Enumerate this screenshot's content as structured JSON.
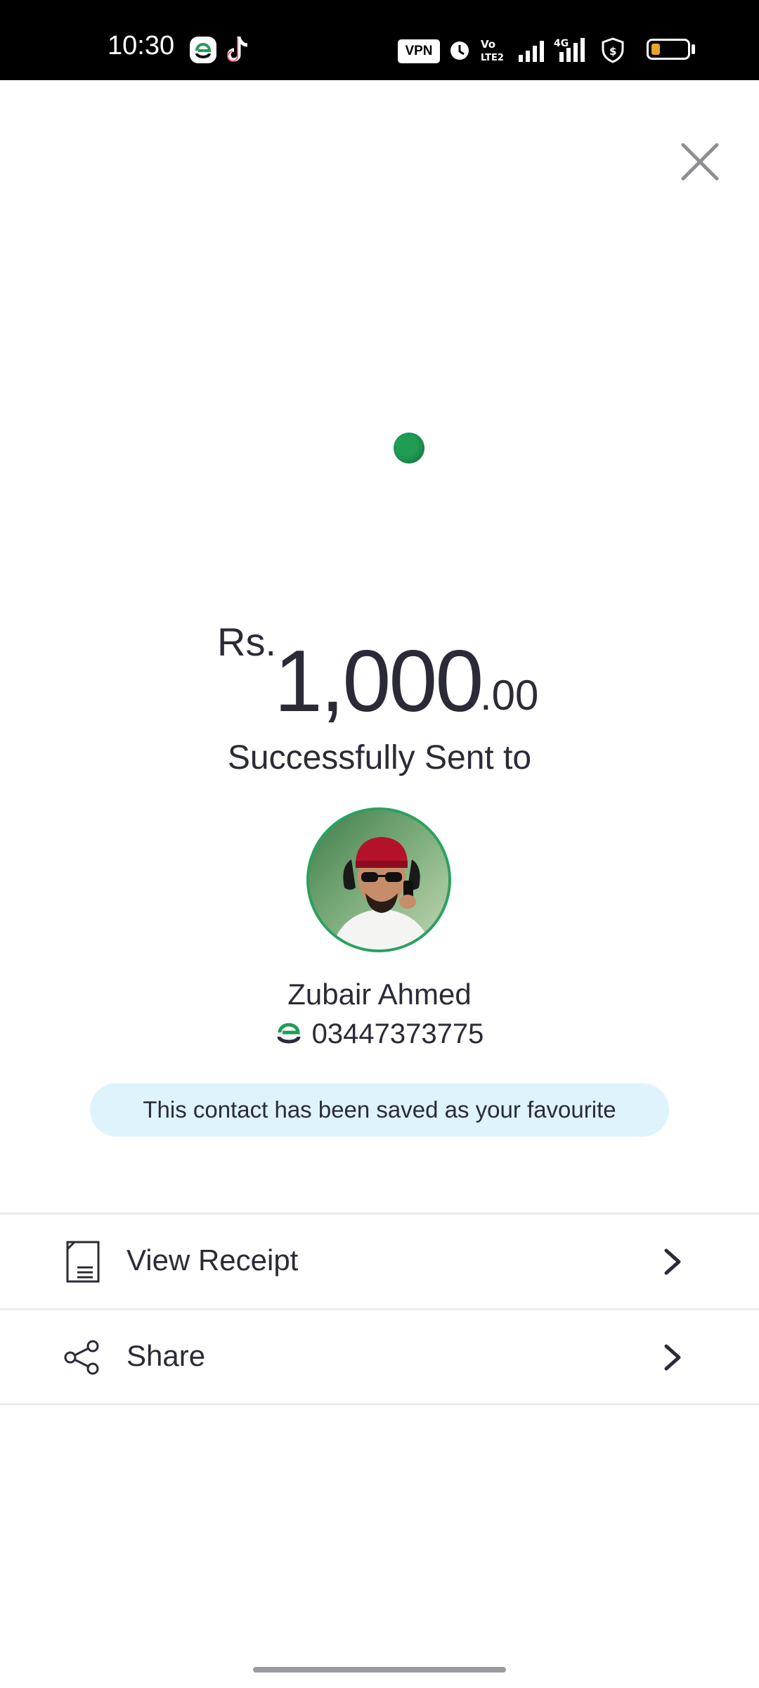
{
  "status_bar": {
    "time": "10:30",
    "vpn": "VPN",
    "icons": [
      "easypaisa-app-icon",
      "tiktok-icon",
      "alarm-icon",
      "volte-icon",
      "signal-icon",
      "4g-signal-icon",
      "shield-dollar-icon",
      "battery-icon"
    ]
  },
  "transaction": {
    "currency": "Rs.",
    "amount_whole": "1,000",
    "amount_decimal": ".00",
    "status_text": "Successfully Sent to"
  },
  "recipient": {
    "name": "Zubair Ahmed",
    "phone": "03447373775",
    "favourite_notice": "This contact has been saved as your favourite"
  },
  "actions": [
    {
      "label": "View Receipt",
      "icon": "receipt-icon"
    },
    {
      "label": "Share",
      "icon": "share-icon"
    }
  ],
  "colors": {
    "brand_green": "#1f9d55",
    "banner_bg": "#dff3fc",
    "text": "#2b2b38"
  }
}
